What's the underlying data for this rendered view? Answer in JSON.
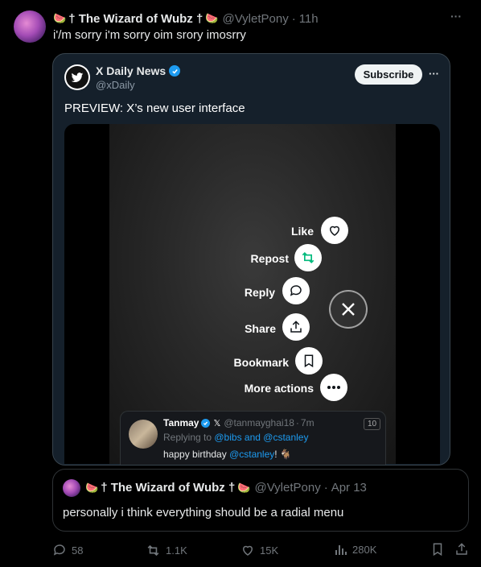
{
  "post": {
    "emoji": "🍉",
    "author_name": "† The Wizard of Wubz †",
    "handle": "@VyletPony",
    "dot": "·",
    "time": "11h",
    "more": "···",
    "text": "i'/m sorry i'm sorry oim srory imosrry"
  },
  "embed": {
    "name": "X Daily News",
    "handle": "@xDaily",
    "subscribe": "Subscribe",
    "more": "···",
    "title": "PREVIEW: X’s new user interface",
    "menu": [
      {
        "label": "Like",
        "icon": "heart-icon"
      },
      {
        "label": "Repost",
        "icon": "repost-icon"
      },
      {
        "label": "Reply",
        "icon": "reply-icon"
      },
      {
        "label": "Share",
        "icon": "share-icon"
      },
      {
        "label": "Bookmark",
        "icon": "bookmark-icon"
      },
      {
        "label": "More actions",
        "icon": "more-icon"
      }
    ],
    "inner": {
      "name": "Tanmay",
      "x_mark": "𝕏",
      "handle": "@tanmayghai18",
      "dot": "·",
      "time": "7m",
      "badge": "10",
      "replying_prefix": "Replying to ",
      "replying_users": "@bibs and @cstanley",
      "text_prefix": "happy birthday ",
      "mention": "@cstanley",
      "text_suffix": "! 🐐"
    }
  },
  "quote": {
    "emoji": "🍉",
    "author_name": "† The Wizard of Wubz †",
    "handle": "@VyletPony",
    "dot": "·",
    "date": "Apr 13",
    "text": "personally i think everything should be a radial menu"
  },
  "stats": {
    "replies": "58",
    "reposts": "1.1K",
    "likes": "15K",
    "views": "280K"
  },
  "colors": {
    "accent": "#1d9bf0",
    "repost_green": "#00ba7c",
    "background": "#000000"
  }
}
